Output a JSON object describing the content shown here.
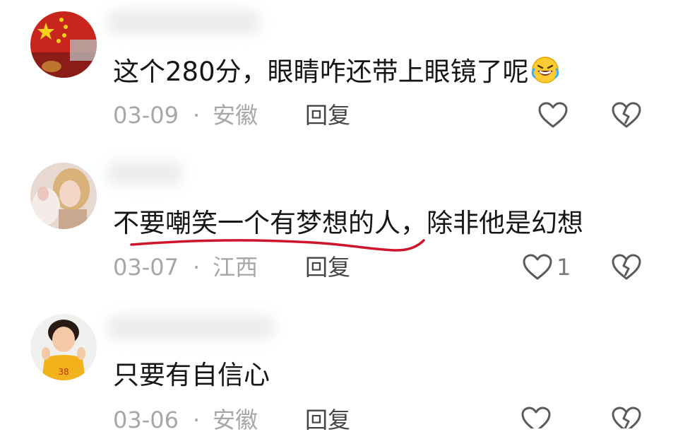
{
  "comments": [
    {
      "text": "这个280分，眼睛咋还带上眼镜了呢",
      "emoji_icon": "rofl-emoji-icon",
      "date": "03-09",
      "separator": "·",
      "location": "安徽",
      "reply_label": "回复",
      "like_count": ""
    },
    {
      "text_underlined": "不要嘲笑一个有梦想的人",
      "text_rest": "，除非他是幻想",
      "date": "03-07",
      "separator": "·",
      "location": "江西",
      "reply_label": "回复",
      "like_count": "1"
    },
    {
      "text": "只要有自信心",
      "date": "03-06",
      "separator": "·",
      "location": "安徽",
      "reply_label": "回复",
      "like_count": ""
    }
  ],
  "colors": {
    "text": "#161616",
    "meta": "#a7a7a7",
    "reply": "#454545",
    "underline_annotation": "#d0142c",
    "icon_stroke": "#5a5a5a"
  }
}
